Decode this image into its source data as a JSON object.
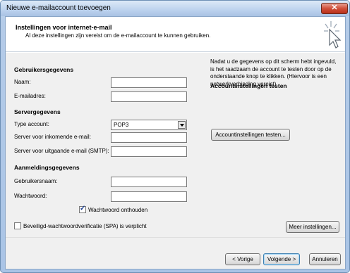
{
  "window": {
    "title": "Nieuwe e-mailaccount toevoegen",
    "close_glyph": "✕"
  },
  "header": {
    "title": "Instellingen voor internet-e-mail",
    "subtitle": "Al deze instellingen zijn vereist om de e-mailaccount te kunnen gebruiken."
  },
  "left": {
    "user_section": "Gebruikersgegevens",
    "name_label": "Naam:",
    "name_value": "",
    "email_label": "E-mailadres:",
    "email_value": "",
    "server_section": "Servergegevens",
    "account_type_label": "Type account:",
    "account_type_value": "POP3",
    "incoming_label": "Server voor inkomende e-mail:",
    "incoming_value": "",
    "outgoing_label": "Server voor uitgaande e-mail (SMTP):",
    "outgoing_value": "",
    "login_section": "Aanmeldingsgegevens",
    "username_label": "Gebruikersnaam:",
    "username_value": "",
    "password_label": "Wachtwoord:",
    "password_value": "",
    "remember_password_label": "Wachtwoord onthouden",
    "remember_password_checked": true,
    "spa_label": "Beveiligd-wachtwoordverificatie (SPA) is verplicht",
    "spa_checked": false
  },
  "right": {
    "section": "Accountinstellingen testen",
    "description": "Nadat u de gegevens op dit scherm hebt ingevuld, is het raadzaam de account te testen door op de onderstaande knop te klikken. (Hiervoor is een netwerkverbinding vereist)",
    "test_button": "Accountinstellingen testen...",
    "more_settings_button": "Meer instellingen..."
  },
  "footer": {
    "back_button": "< Vorige",
    "next_button": "Volgende >",
    "cancel_button": "Annuleren"
  }
}
